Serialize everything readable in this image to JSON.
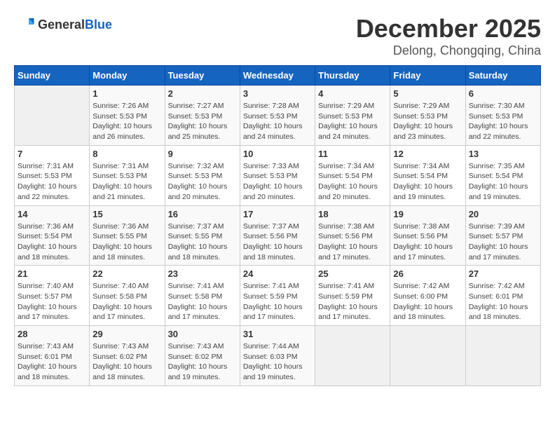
{
  "header": {
    "logo_general": "General",
    "logo_blue": "Blue",
    "month": "December 2025",
    "location": "Delong, Chongqing, China"
  },
  "weekdays": [
    "Sunday",
    "Monday",
    "Tuesday",
    "Wednesday",
    "Thursday",
    "Friday",
    "Saturday"
  ],
  "weeks": [
    [
      {
        "day": "",
        "info": ""
      },
      {
        "day": "1",
        "info": "Sunrise: 7:26 AM\nSunset: 5:53 PM\nDaylight: 10 hours\nand 26 minutes."
      },
      {
        "day": "2",
        "info": "Sunrise: 7:27 AM\nSunset: 5:53 PM\nDaylight: 10 hours\nand 25 minutes."
      },
      {
        "day": "3",
        "info": "Sunrise: 7:28 AM\nSunset: 5:53 PM\nDaylight: 10 hours\nand 24 minutes."
      },
      {
        "day": "4",
        "info": "Sunrise: 7:29 AM\nSunset: 5:53 PM\nDaylight: 10 hours\nand 24 minutes."
      },
      {
        "day": "5",
        "info": "Sunrise: 7:29 AM\nSunset: 5:53 PM\nDaylight: 10 hours\nand 23 minutes."
      },
      {
        "day": "6",
        "info": "Sunrise: 7:30 AM\nSunset: 5:53 PM\nDaylight: 10 hours\nand 22 minutes."
      }
    ],
    [
      {
        "day": "7",
        "info": "Sunrise: 7:31 AM\nSunset: 5:53 PM\nDaylight: 10 hours\nand 22 minutes."
      },
      {
        "day": "8",
        "info": "Sunrise: 7:31 AM\nSunset: 5:53 PM\nDaylight: 10 hours\nand 21 minutes."
      },
      {
        "day": "9",
        "info": "Sunrise: 7:32 AM\nSunset: 5:53 PM\nDaylight: 10 hours\nand 20 minutes."
      },
      {
        "day": "10",
        "info": "Sunrise: 7:33 AM\nSunset: 5:53 PM\nDaylight: 10 hours\nand 20 minutes."
      },
      {
        "day": "11",
        "info": "Sunrise: 7:34 AM\nSunset: 5:54 PM\nDaylight: 10 hours\nand 20 minutes."
      },
      {
        "day": "12",
        "info": "Sunrise: 7:34 AM\nSunset: 5:54 PM\nDaylight: 10 hours\nand 19 minutes."
      },
      {
        "day": "13",
        "info": "Sunrise: 7:35 AM\nSunset: 5:54 PM\nDaylight: 10 hours\nand 19 minutes."
      }
    ],
    [
      {
        "day": "14",
        "info": "Sunrise: 7:36 AM\nSunset: 5:54 PM\nDaylight: 10 hours\nand 18 minutes."
      },
      {
        "day": "15",
        "info": "Sunrise: 7:36 AM\nSunset: 5:55 PM\nDaylight: 10 hours\nand 18 minutes."
      },
      {
        "day": "16",
        "info": "Sunrise: 7:37 AM\nSunset: 5:55 PM\nDaylight: 10 hours\nand 18 minutes."
      },
      {
        "day": "17",
        "info": "Sunrise: 7:37 AM\nSunset: 5:56 PM\nDaylight: 10 hours\nand 18 minutes."
      },
      {
        "day": "18",
        "info": "Sunrise: 7:38 AM\nSunset: 5:56 PM\nDaylight: 10 hours\nand 17 minutes."
      },
      {
        "day": "19",
        "info": "Sunrise: 7:38 AM\nSunset: 5:56 PM\nDaylight: 10 hours\nand 17 minutes."
      },
      {
        "day": "20",
        "info": "Sunrise: 7:39 AM\nSunset: 5:57 PM\nDaylight: 10 hours\nand 17 minutes."
      }
    ],
    [
      {
        "day": "21",
        "info": "Sunrise: 7:40 AM\nSunset: 5:57 PM\nDaylight: 10 hours\nand 17 minutes."
      },
      {
        "day": "22",
        "info": "Sunrise: 7:40 AM\nSunset: 5:58 PM\nDaylight: 10 hours\nand 17 minutes."
      },
      {
        "day": "23",
        "info": "Sunrise: 7:41 AM\nSunset: 5:58 PM\nDaylight: 10 hours\nand 17 minutes."
      },
      {
        "day": "24",
        "info": "Sunrise: 7:41 AM\nSunset: 5:59 PM\nDaylight: 10 hours\nand 17 minutes."
      },
      {
        "day": "25",
        "info": "Sunrise: 7:41 AM\nSunset: 5:59 PM\nDaylight: 10 hours\nand 17 minutes."
      },
      {
        "day": "26",
        "info": "Sunrise: 7:42 AM\nSunset: 6:00 PM\nDaylight: 10 hours\nand 18 minutes."
      },
      {
        "day": "27",
        "info": "Sunrise: 7:42 AM\nSunset: 6:01 PM\nDaylight: 10 hours\nand 18 minutes."
      }
    ],
    [
      {
        "day": "28",
        "info": "Sunrise: 7:43 AM\nSunset: 6:01 PM\nDaylight: 10 hours\nand 18 minutes."
      },
      {
        "day": "29",
        "info": "Sunrise: 7:43 AM\nSunset: 6:02 PM\nDaylight: 10 hours\nand 18 minutes."
      },
      {
        "day": "30",
        "info": "Sunrise: 7:43 AM\nSunset: 6:02 PM\nDaylight: 10 hours\nand 19 minutes."
      },
      {
        "day": "31",
        "info": "Sunrise: 7:44 AM\nSunset: 6:03 PM\nDaylight: 10 hours\nand 19 minutes."
      },
      {
        "day": "",
        "info": ""
      },
      {
        "day": "",
        "info": ""
      },
      {
        "day": "",
        "info": ""
      }
    ]
  ]
}
